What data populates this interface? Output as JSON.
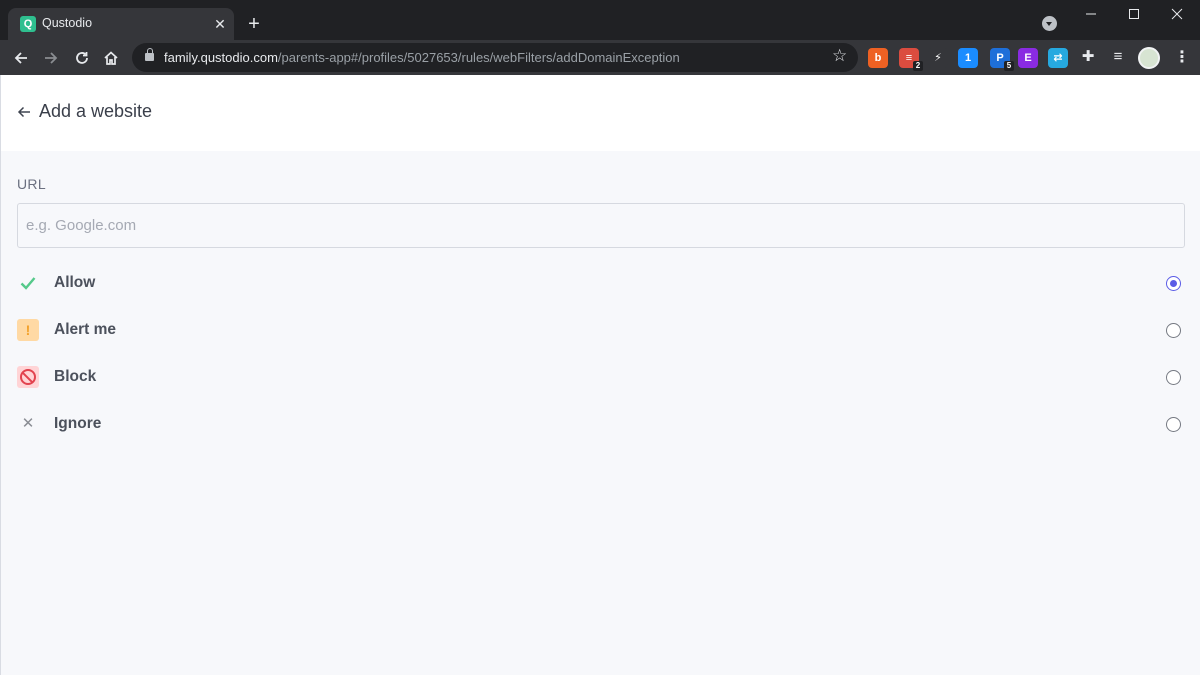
{
  "browser": {
    "tab_title": "Qustodio",
    "tab_favicon_letter": "Q",
    "tab_close_glyph": "✕",
    "new_tab_glyph": "+",
    "url_host": "family.qustodio.com",
    "url_path": "/parents-app#/profiles/5027653/rules/webFilters/addDomainException",
    "extensions": [
      {
        "name": "bitly-extension",
        "letter": "b",
        "color": "#ee6123"
      },
      {
        "name": "todoist-extension",
        "letter": "≡",
        "color": "#db4c3f",
        "badge": "2"
      },
      {
        "name": "lightning-extension",
        "letter": "⚡",
        "color": "#35363a"
      },
      {
        "name": "1password-extension",
        "letter": "1",
        "color": "#1a8cff"
      },
      {
        "name": "pushbullet-extension",
        "letter": "P",
        "color": "#1e6fd9",
        "badge": "5"
      },
      {
        "name": "e-extension",
        "letter": "E",
        "color": "#8a2be2"
      },
      {
        "name": "link-extension",
        "letter": "⇄",
        "color": "#26a9e0"
      }
    ]
  },
  "page": {
    "title": "Add a website",
    "url_label": "URL",
    "url_placeholder": "e.g. Google.com",
    "url_value": "",
    "selected_option": "allow",
    "options": [
      {
        "id": "allow",
        "label": "Allow",
        "icon": "check-icon"
      },
      {
        "id": "alert",
        "label": "Alert me",
        "icon": "exclamation-icon"
      },
      {
        "id": "block",
        "label": "Block",
        "icon": "block-icon"
      },
      {
        "id": "ignore",
        "label": "Ignore",
        "icon": "x-icon"
      }
    ]
  },
  "colors": {
    "accent": "#5b5ce6",
    "allow": "#55c98a",
    "alert": "#f3a12b",
    "block": "#e2434f"
  }
}
